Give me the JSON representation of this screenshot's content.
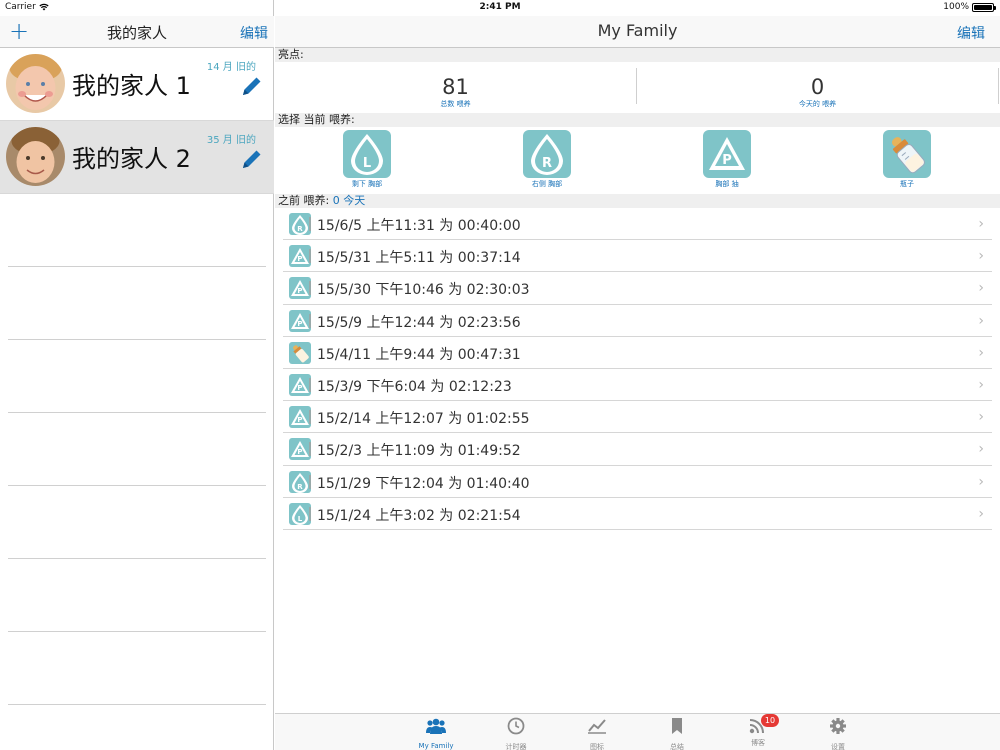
{
  "status": {
    "carrier": "Carrier",
    "time": "2:41 PM",
    "battery": "100%"
  },
  "left": {
    "add_label": "+",
    "title": "我的家人",
    "edit_label": "编辑",
    "people": [
      {
        "name": "我的家人 1",
        "age": "14 月 旧的"
      },
      {
        "name": "我的家人 2",
        "age": "35 月 旧的"
      }
    ]
  },
  "right": {
    "title": "My Family",
    "edit_label": "编辑",
    "highlights_header": "亮点:",
    "stats": [
      {
        "value": "81",
        "label": "总数 喂养"
      },
      {
        "value": "0",
        "label": "今天的 喂养"
      }
    ],
    "select_header": "选择 当前 喂养:",
    "feed_buttons": [
      {
        "label": "剩下 胸部",
        "icon": "left-breast-icon",
        "letter": "L"
      },
      {
        "label": "右侧 胸部",
        "icon": "right-breast-icon",
        "letter": "R"
      },
      {
        "label": "胸部 抽",
        "icon": "pump-icon",
        "letter": "P"
      },
      {
        "label": "瓶子",
        "icon": "bottle-icon",
        "letter": ""
      }
    ],
    "previous_header": "之前 喂养:",
    "previous_today": "0 今天",
    "feedings": [
      {
        "type": "R",
        "text": "15/6/5 上午11:31 为 00:40:00"
      },
      {
        "type": "P",
        "text": "15/5/31 上午5:11 为 00:37:14"
      },
      {
        "type": "P",
        "text": "15/5/30 下午10:46 为 02:30:03"
      },
      {
        "type": "P",
        "text": "15/5/9 上午12:44 为 02:23:56"
      },
      {
        "type": "B",
        "text": "15/4/11 上午9:44 为 00:47:31"
      },
      {
        "type": "P",
        "text": "15/3/9 下午6:04 为 02:12:23"
      },
      {
        "type": "P",
        "text": "15/2/14 上午12:07 为 01:02:55"
      },
      {
        "type": "P",
        "text": "15/2/3 上午11:09 为 01:49:52"
      },
      {
        "type": "R",
        "text": "15/1/29 下午12:04 为 01:40:40"
      },
      {
        "type": "L",
        "text": "15/1/24 上午3:02 为 02:21:54"
      }
    ]
  },
  "tabs": [
    {
      "label": "My Family",
      "icon": "family-icon",
      "active": true
    },
    {
      "label": "计时器",
      "icon": "timer-icon"
    },
    {
      "label": "图标",
      "icon": "chart-icon"
    },
    {
      "label": "总结",
      "icon": "bookmark-icon"
    },
    {
      "label": "博客",
      "icon": "rss-icon",
      "badge": "10"
    },
    {
      "label": "设置",
      "icon": "gear-icon"
    }
  ],
  "colors": {
    "accent": "#1a73b8",
    "teal": "#7fc4c8",
    "badge": "#e53935"
  }
}
